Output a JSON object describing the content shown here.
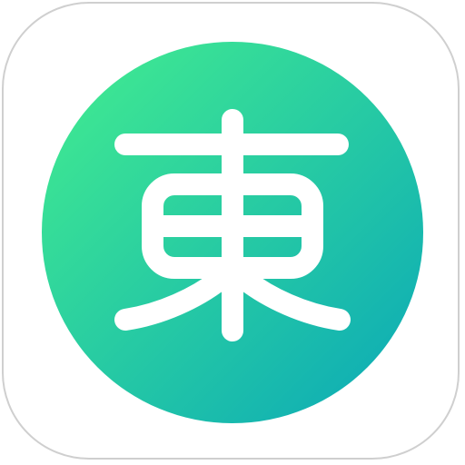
{
  "app_icon": {
    "glyph": "東",
    "glyph_color": "#ffffff",
    "tile_border_color": "#cfcfcf",
    "tile_background": "#ffffff",
    "gradient": {
      "start": "#44ee8e",
      "end": "#0aa8b8"
    }
  }
}
